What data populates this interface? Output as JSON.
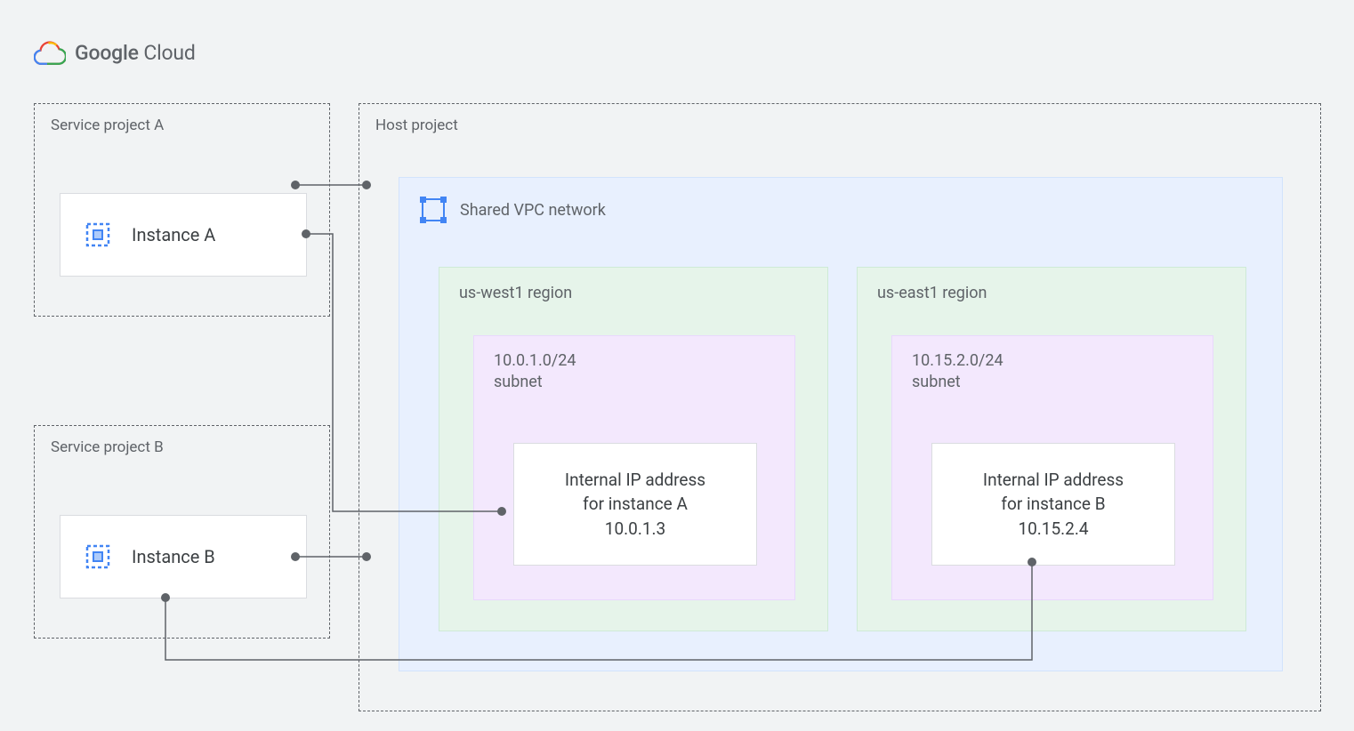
{
  "brand": {
    "google": "Google",
    "cloud": "Cloud"
  },
  "serviceProjectA": {
    "label": "Service project A",
    "instance": "Instance A"
  },
  "serviceProjectB": {
    "label": "Service project B",
    "instance": "Instance B"
  },
  "hostProject": {
    "label": "Host project"
  },
  "vpc": {
    "label": "Shared VPC network"
  },
  "regionWest": {
    "label": "us-west1 region",
    "subnetCidr": "10.0.1.0/24",
    "subnetWord": "subnet",
    "ipTitle": "Internal IP address",
    "ipFor": "for instance A",
    "ipAddr": "10.0.1.3"
  },
  "regionEast": {
    "label": "us-east1 region",
    "subnetCidr": "10.15.2.0/24",
    "subnetWord": "subnet",
    "ipTitle": "Internal IP address",
    "ipFor": "for instance B",
    "ipAddr": "10.15.2.4"
  }
}
